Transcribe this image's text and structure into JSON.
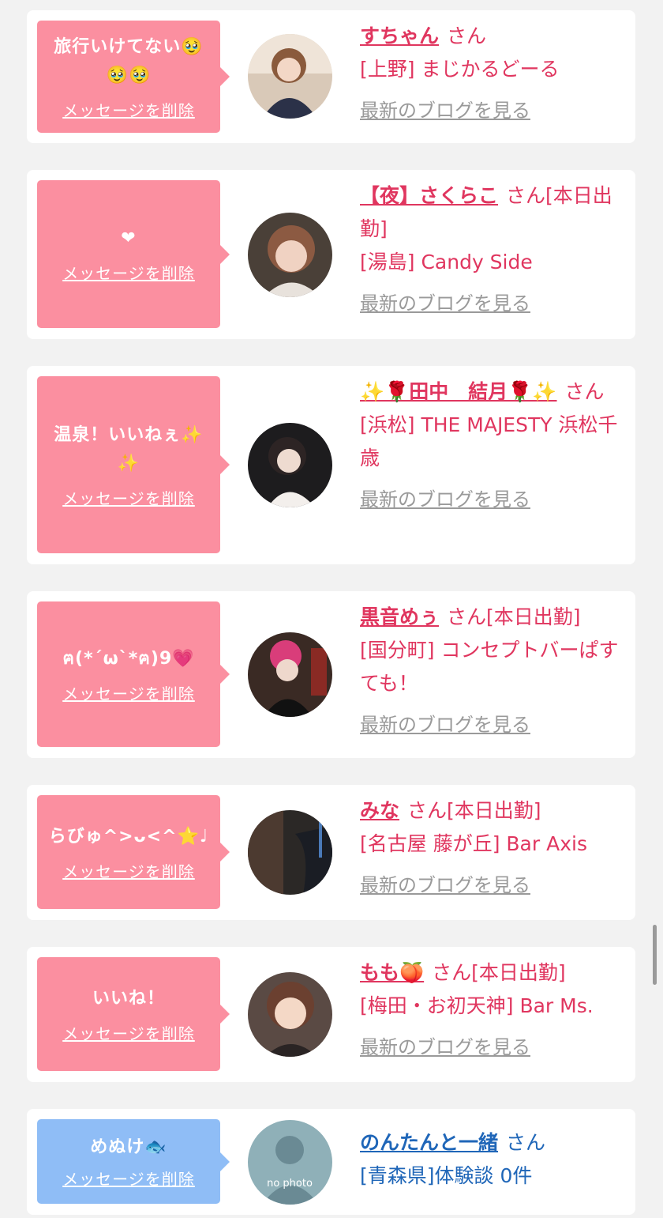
{
  "delete_label": "メッセージを削除",
  "blog_label": "最新のブログを見る",
  "san_label": "さん",
  "colors": {
    "pink": "#fb8fa0",
    "blue": "#8fbdf6",
    "name_pink": "#e0365f",
    "name_blue": "#1f66b8"
  },
  "entries": [
    {
      "message": "旅行いけてない🥹🥹🥹",
      "name": "すちゃん",
      "status": "",
      "shop": "[上野] まじかるどーる",
      "has_blog": true
    },
    {
      "message": "❤",
      "name": "【夜】さくらこ",
      "status": "[本日出勤]",
      "shop": "[湯島] Candy Side",
      "has_blog": true
    },
    {
      "message": "温泉！いいねぇ✨✨",
      "name": "✨🌹田中　結月🌹✨",
      "status": "",
      "shop": "[浜松] THE MAJESTY 浜松千歳",
      "has_blog": true
    },
    {
      "message": "ฅ(*´ω`*ฅ)9💗",
      "name": "黒音めぅ",
      "status": "[本日出勤]",
      "shop": "[国分町] コンセプトバーぱすても！",
      "has_blog": true
    },
    {
      "message": "らびゅ^>ᴗ<^⭐️♩",
      "name": "みな",
      "status": "[本日出勤]",
      "shop": "[名古屋 藤が丘] Bar Axis",
      "has_blog": true
    },
    {
      "message": "いいね！",
      "name": "もも🍑",
      "status": "[本日出勤]",
      "shop": "[梅田・お初天神] Bar Ms.",
      "has_blog": true
    },
    {
      "message": "めぬけ🐟",
      "name": "のんたんと一緒",
      "status": "",
      "shop": "[青森県]体験談 0件",
      "has_blog": false,
      "avatar_text": "no photo"
    }
  ]
}
